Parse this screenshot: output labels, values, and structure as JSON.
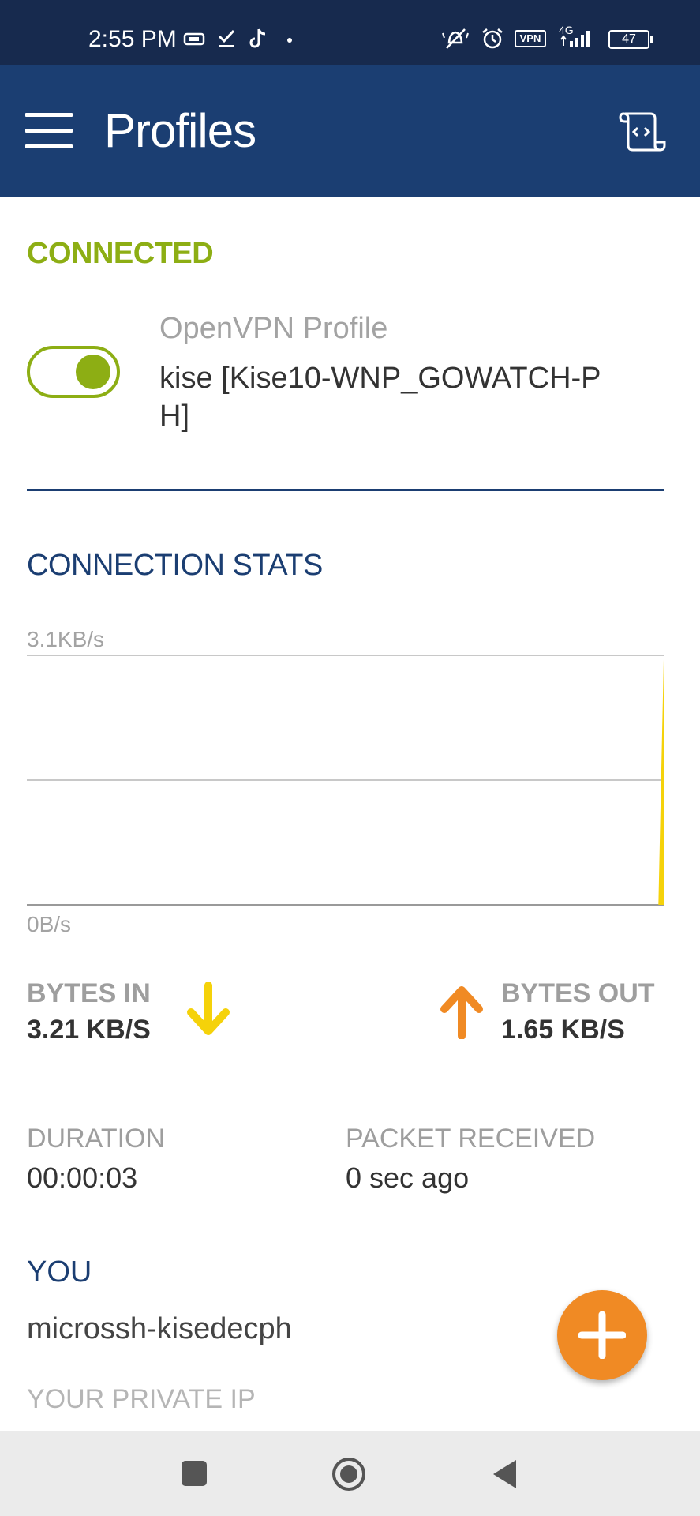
{
  "status_bar": {
    "time": "2:55 PM",
    "network": "4G",
    "vpn_badge": "VPN",
    "battery": "47",
    "icons": [
      "sim-card-icon",
      "check-icon",
      "tiktok-icon",
      "dot-icon",
      "mute-bell-icon",
      "alarm-icon",
      "vpn-key-icon",
      "signal-icon",
      "battery-icon"
    ]
  },
  "app_bar": {
    "title": "Profiles",
    "menu_icon": "hamburger-menu-icon",
    "action_icon": "import-profile-icon"
  },
  "connection": {
    "status": "CONNECTED",
    "profile_type": "OpenVPN Profile",
    "profile_name": "kise [Kise10-WNP_GOWATCH-PH]",
    "toggle_on": true
  },
  "stats": {
    "title": "CONNECTION STATS",
    "chart_data": {
      "type": "area",
      "y_max_label": "3.1KB/s",
      "y_min_label": "0B/s",
      "ylim": [
        0,
        3.1
      ],
      "series": [
        {
          "color": "#f5d20a",
          "x": [
            0,
            1,
            2,
            3,
            4,
            5,
            6,
            7,
            8,
            9,
            10,
            11,
            12,
            13,
            14,
            15,
            16,
            17,
            18,
            19,
            20,
            21,
            22,
            23,
            24,
            25,
            26,
            27,
            28,
            29,
            30,
            31,
            32,
            33,
            34,
            35,
            36,
            37,
            38,
            39,
            40,
            41,
            42,
            43,
            44,
            45,
            46,
            47,
            48,
            49,
            50,
            51,
            52,
            53,
            54,
            55,
            56,
            57,
            58,
            59,
            59.5,
            60
          ],
          "y": [
            0,
            0,
            0,
            0,
            0,
            0,
            0,
            0,
            0,
            0,
            0,
            0,
            0,
            0,
            0,
            0,
            0,
            0,
            0,
            0,
            0,
            0,
            0,
            0,
            0,
            0,
            0,
            0,
            0,
            0,
            0,
            0,
            0,
            0,
            0,
            0,
            0,
            0,
            0,
            0,
            0,
            0,
            0,
            0,
            0,
            0,
            0,
            0,
            0,
            0,
            0,
            0,
            0,
            0,
            0,
            0,
            0,
            0,
            0,
            0,
            0,
            3.05
          ]
        }
      ],
      "grid": true
    },
    "bytes_in": {
      "label": "BYTES IN",
      "value": "3.21 KB/S",
      "color": "#f5d20a"
    },
    "bytes_out": {
      "label": "BYTES OUT",
      "value": "1.65 KB/S",
      "color": "#f08a24"
    },
    "duration": {
      "label": "DURATION",
      "value": "00:00:03"
    },
    "packet_received": {
      "label": "PACKET RECEIVED",
      "value": "0 sec ago"
    }
  },
  "you": {
    "title": "YOU",
    "name": "microssh-kisedecph",
    "private_ip_label": "YOUR PRIVATE IP"
  },
  "fab": {
    "icon": "plus-icon",
    "color": "#f08a24"
  },
  "nav_bar": {
    "icons": [
      "recents-square-icon",
      "home-circle-icon",
      "back-triangle-icon"
    ]
  }
}
